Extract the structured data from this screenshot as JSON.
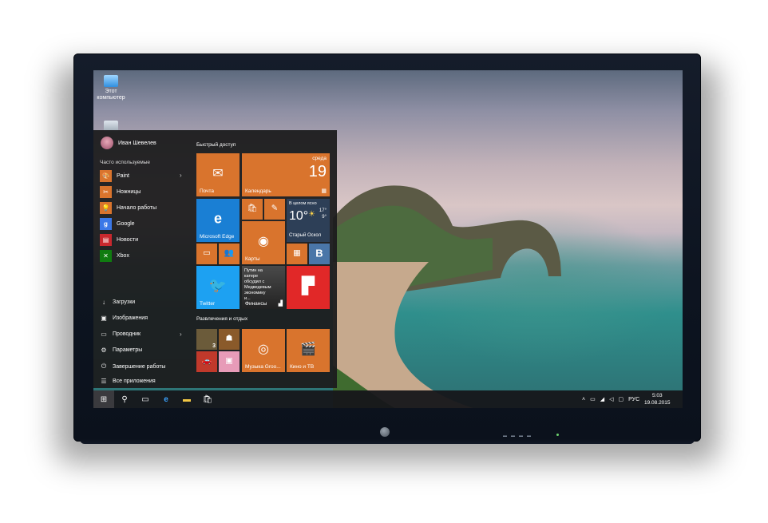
{
  "desktop": {
    "icons": [
      {
        "label": "Этот компьютер"
      }
    ]
  },
  "start_menu": {
    "user_name": "Иван Шевелев",
    "most_used_header": "Часто используемые",
    "apps": [
      {
        "label": "Paint",
        "icon": "paint-icon",
        "color": "#d9742d",
        "has_submenu": true
      },
      {
        "label": "Ножницы",
        "icon": "scissors-icon",
        "color": "#d9742d"
      },
      {
        "label": "Начало работы",
        "icon": "lightbulb-icon",
        "color": "#d9742d"
      },
      {
        "label": "Google",
        "icon": "google-icon",
        "color": "#3b78e7"
      },
      {
        "label": "Новости",
        "icon": "news-icon",
        "color": "#c8282e"
      },
      {
        "label": "Xbox",
        "icon": "xbox-icon",
        "color": "#107c10"
      }
    ],
    "places": [
      {
        "label": "Загрузки",
        "icon": "download-icon"
      },
      {
        "label": "Изображения",
        "icon": "pictures-icon"
      },
      {
        "label": "Проводник",
        "icon": "explorer-icon",
        "has_submenu": true
      },
      {
        "label": "Параметры",
        "icon": "gear-icon"
      },
      {
        "label": "Завершение работы",
        "icon": "power-icon"
      },
      {
        "label": "Все приложения",
        "icon": "all-apps-icon"
      }
    ],
    "quick_access_header": "Быстрый доступ",
    "entertainment_header": "Развлечения и отдых",
    "tiles": {
      "mail": "Почта",
      "calendar": "Календарь",
      "calendar_day_name": "среда",
      "calendar_day_number": "19",
      "edge": "Microsoft Edge",
      "weather_desc": "В целом ясно",
      "weather_temp": "10°",
      "weather_high": "17°",
      "weather_low": "9°",
      "weather_city": "Старый Оскол",
      "maps": "Карты",
      "twitter": "Twitter",
      "news_headline": "Путин на катере обсудил с Медведевым экономику и...",
      "finance": "Финансы",
      "music": "Музыка Groo...",
      "movies": "Кино и ТВ"
    }
  },
  "taskbar": {
    "language": "РУС",
    "time": "5:03",
    "date": "19.08.2015"
  },
  "colors": {
    "accent": "#d9742d",
    "edge_blue": "#1a7fd4",
    "flipboard_red": "#e12828",
    "vk_blue": "#4a76a8"
  }
}
